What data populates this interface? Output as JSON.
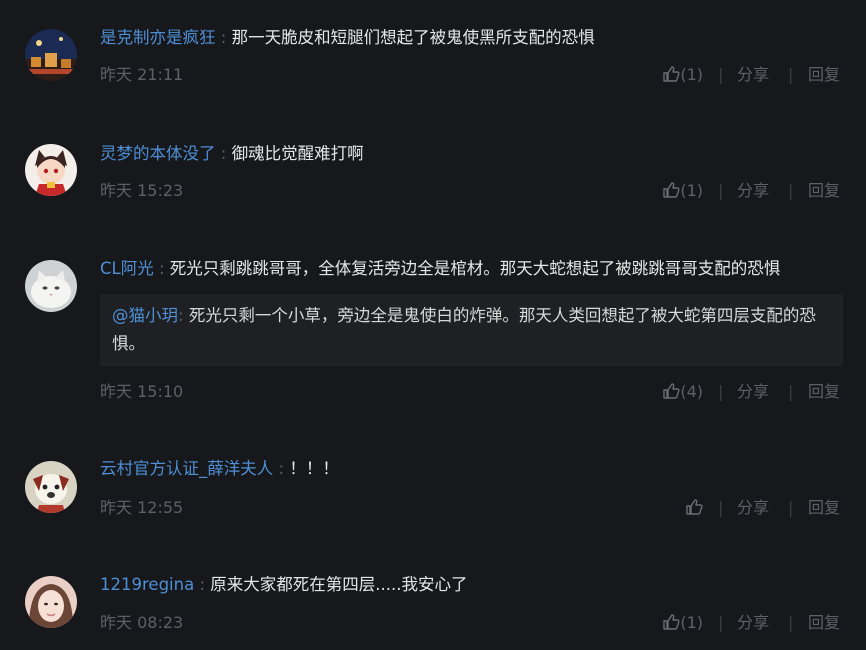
{
  "comments": [
    {
      "user": "是克制亦是疯狂",
      "colon": ":",
      "text": "那一天脆皮和短腿们想起了被鬼使黑所支配的恐惧",
      "time": "昨天 21:11",
      "like_count": "(1)",
      "share": "分享",
      "reply": "回复",
      "avatar": "avatar-night-city"
    },
    {
      "user": "灵梦的本体没了",
      "colon": ":",
      "text": "御魂比觉醒难打啊",
      "time": "昨天 15:23",
      "like_count": "(1)",
      "share": "分享",
      "reply": "回复",
      "avatar": "avatar-anime-cat-girl"
    },
    {
      "user": "CL阿光",
      "colon": ":",
      "text": "死光只剩跳跳哥哥，全体复活旁边全是棺材。那天大蛇想起了被跳跳哥哥支配的恐惧",
      "quote_user": "@猫小玥",
      "quote_colon": ":",
      "quote_text": "死光只剩一个小草，旁边全是鬼使白的炸弹。那天人类回想起了被大蛇第四层支配的恐惧。",
      "time": "昨天 15:10",
      "like_count": "(4)",
      "share": "分享",
      "reply": "回复",
      "avatar": "avatar-white-cat"
    },
    {
      "user": "云村官方认证_薛洋夫人",
      "colon": ":",
      "text": "！！！",
      "time": "昨天 12:55",
      "like_count": "",
      "share": "分享",
      "reply": "回复",
      "avatar": "avatar-cartoon-dog"
    },
    {
      "user": "1219regina",
      "colon": ":",
      "text": "原来大家都死在第四层.....我安心了",
      "time": "昨天 08:23",
      "like_count": "(1)",
      "share": "分享",
      "reply": "回复",
      "avatar": "avatar-girl-portrait"
    }
  ],
  "separator": "|",
  "colors": {
    "background": "#16181c",
    "username": "#4e8fd6",
    "meta": "#5d6167",
    "quote_bg": "#1e2024"
  }
}
